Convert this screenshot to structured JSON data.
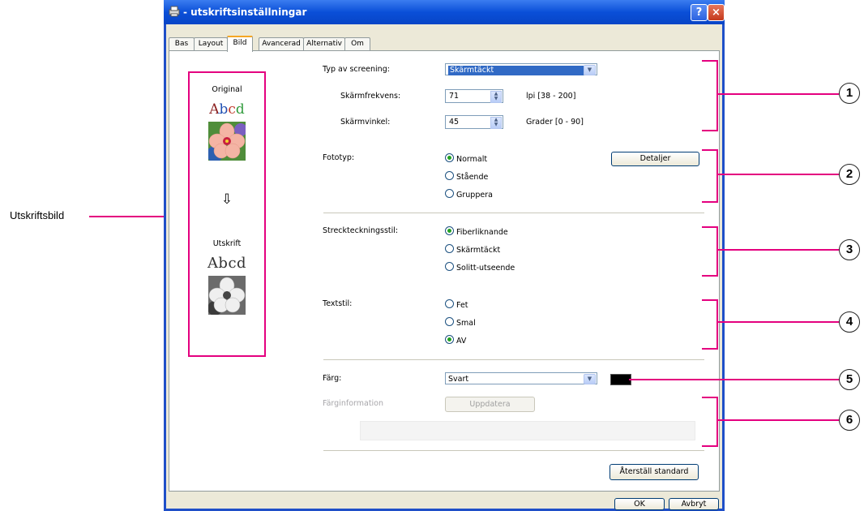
{
  "window": {
    "title": "- utskriftsinställningar",
    "help": "?",
    "close": "×"
  },
  "tabs": [
    "Bas",
    "Layout",
    "Bild",
    "Avancerad",
    "Alternativ",
    "Om"
  ],
  "preview": {
    "original_label": "Original",
    "original_sample": "Abcd",
    "output_label": "Utskrift",
    "output_sample": "Abcd",
    "arrow": "⇩"
  },
  "screening": {
    "label": "Typ av screening:",
    "value": "Skärmtäckt",
    "freq_label": "Skärmfrekvens:",
    "freq_value": "71",
    "freq_range": "lpi [38 - 200]",
    "angle_label": "Skärmvinkel:",
    "angle_value": "45",
    "angle_range": "Grader [0 - 90]"
  },
  "phototype": {
    "label": "Fototyp:",
    "options": [
      "Normalt",
      "Stående",
      "Gruppera"
    ],
    "details_button": "Detaljer"
  },
  "linestyle": {
    "label": "Streckteckningsstil:",
    "options": [
      "Fiberliknande",
      "Skärmtäckt",
      "Solitt-utseende"
    ]
  },
  "textstyle": {
    "label": "Textstil:",
    "options": [
      "Fet",
      "Smal",
      "AV"
    ]
  },
  "color": {
    "label": "Färg:",
    "value": "Svart",
    "info_label": "Färginformation",
    "update_button": "Uppdatera"
  },
  "buttons": {
    "reset": "Återställ standard",
    "ok": "OK",
    "cancel": "Avbryt"
  },
  "annotations": {
    "side_label": "Utskriftsbild",
    "numbers": [
      "1",
      "2",
      "3",
      "4",
      "5",
      "6"
    ]
  },
  "colors": {
    "annotation": "#e4007f",
    "title_bar": "#0a4fd8"
  }
}
